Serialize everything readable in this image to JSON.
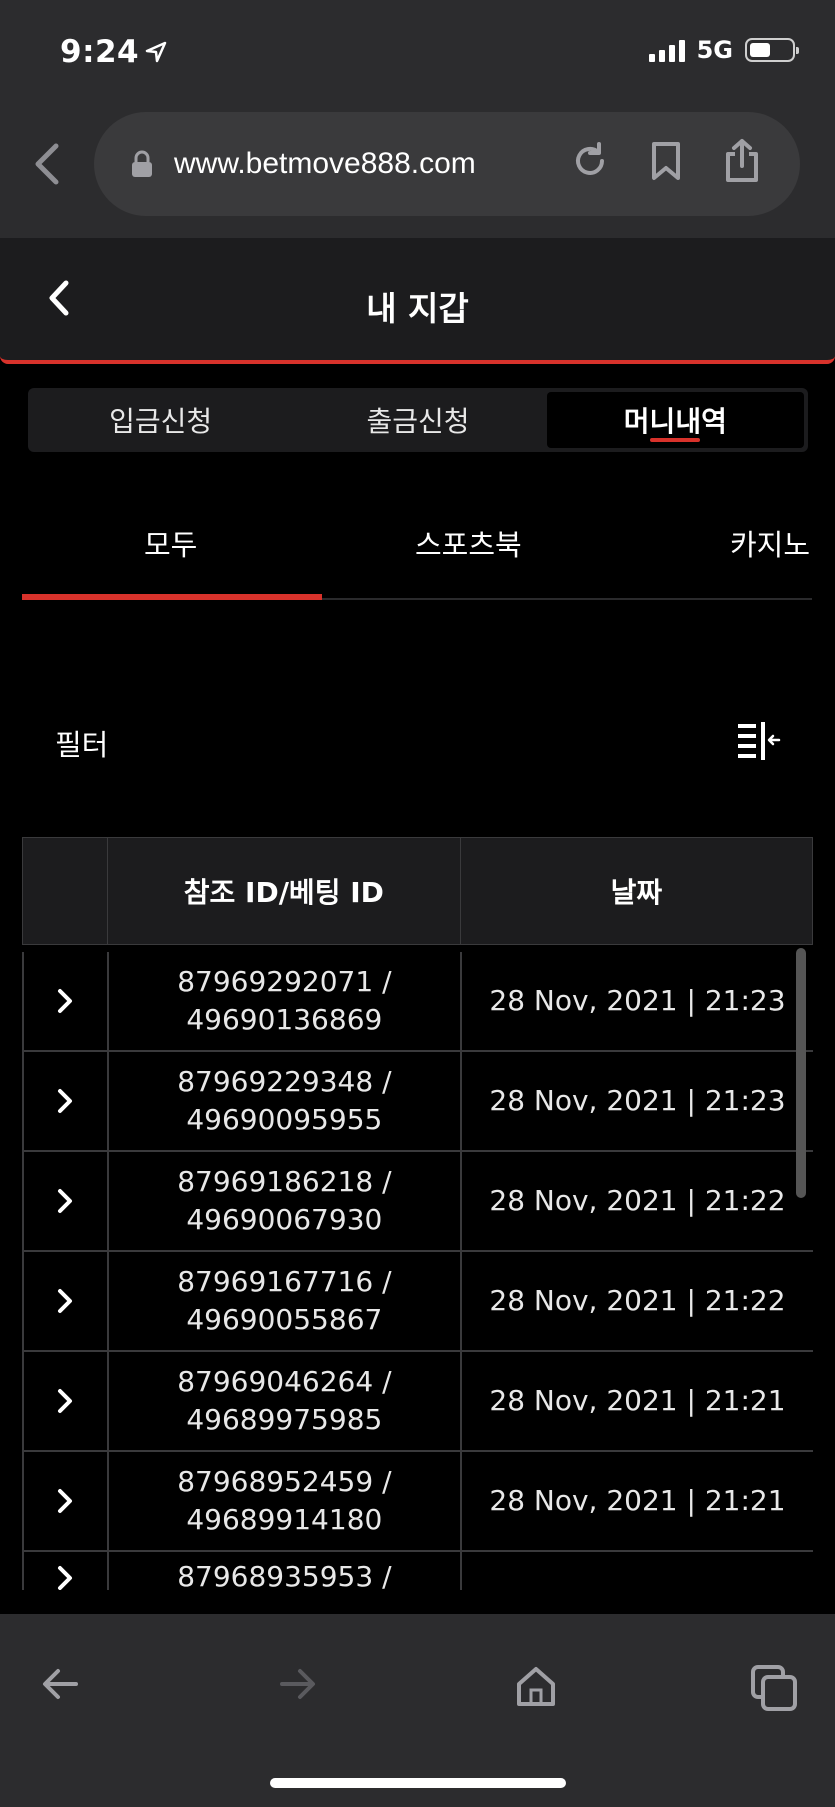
{
  "status_bar": {
    "time": "9:24",
    "network": "5G"
  },
  "browser": {
    "url": "www.betmove888.com"
  },
  "header": {
    "title": "내 지갑"
  },
  "segments": [
    {
      "label": "입금신청",
      "active": false
    },
    {
      "label": "출금신청",
      "active": false
    },
    {
      "label": "머니내역",
      "active": true
    }
  ],
  "categories": [
    {
      "label": "모두",
      "active": true
    },
    {
      "label": "스포츠북",
      "active": false
    },
    {
      "label": "카지노",
      "active": false
    }
  ],
  "filter": {
    "label": "필터"
  },
  "table": {
    "columns": [
      "",
      "참조 ID/베팅 ID",
      "날짜"
    ],
    "rows": [
      {
        "ref_id": "87969292071 /",
        "bet_id": "49690136869",
        "date": "28 Nov, 2021 | 21:23"
      },
      {
        "ref_id": "87969229348 /",
        "bet_id": "49690095955",
        "date": "28 Nov, 2021 | 21:23"
      },
      {
        "ref_id": "87969186218 /",
        "bet_id": "49690067930",
        "date": "28 Nov, 2021 | 21:22"
      },
      {
        "ref_id": "87969167716 /",
        "bet_id": "49690055867",
        "date": "28 Nov, 2021 | 21:22"
      },
      {
        "ref_id": "87969046264 /",
        "bet_id": "49689975985",
        "date": "28 Nov, 2021 | 21:21"
      },
      {
        "ref_id": "87968952459 /",
        "bet_id": "49689914180",
        "date": "28 Nov, 2021 | 21:21"
      },
      {
        "ref_id": "87968935953 /",
        "bet_id": "",
        "date": ""
      }
    ]
  },
  "colors": {
    "accent": "#d8322b",
    "chrome": "#2c2c2e",
    "panel": "#1c1c1e"
  }
}
